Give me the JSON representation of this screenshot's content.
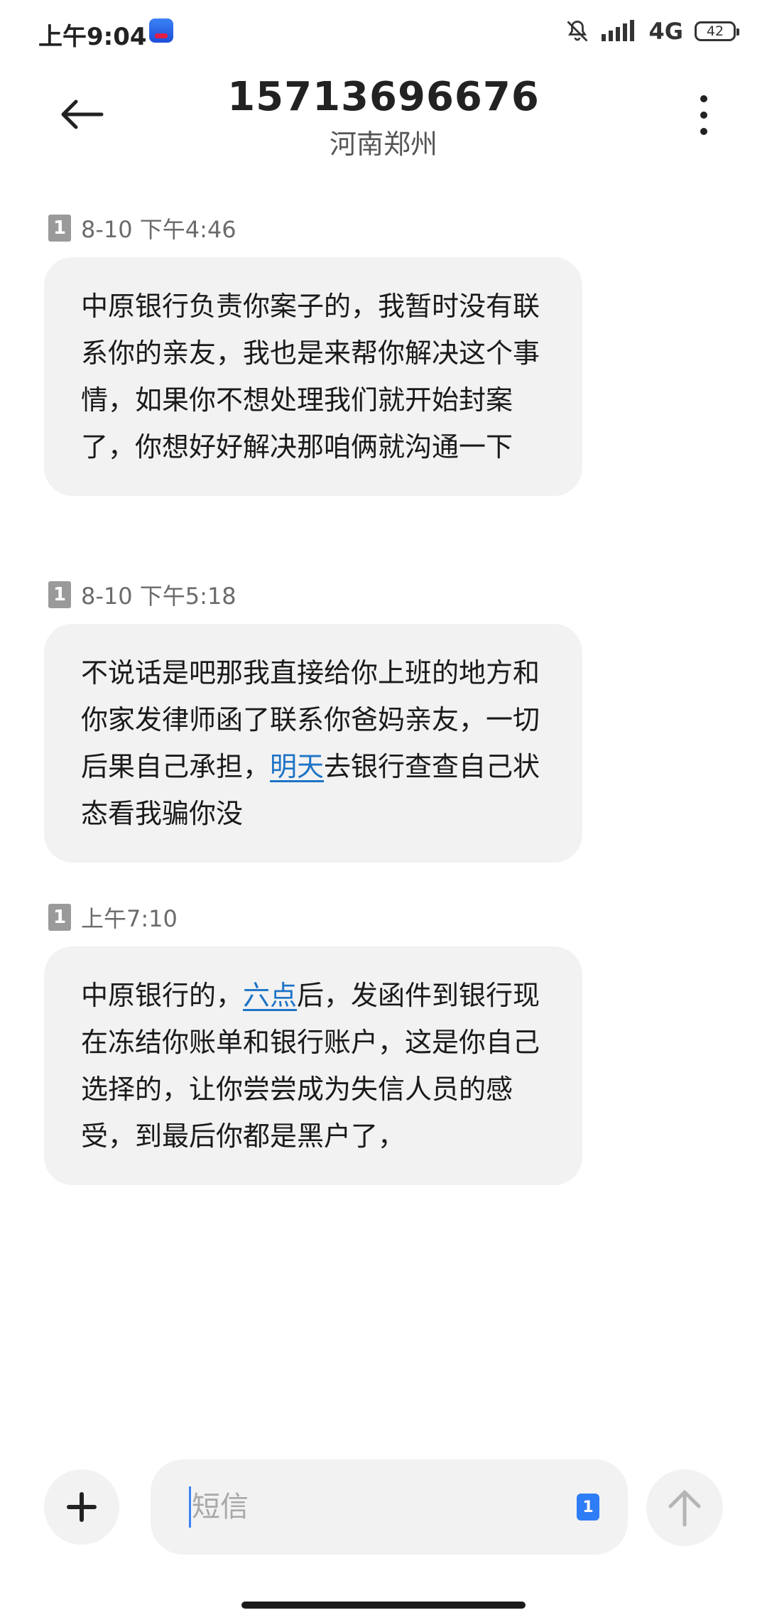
{
  "status_bar": {
    "time": "上午9:04",
    "network": "4G",
    "battery": "42"
  },
  "header": {
    "title": "15713696676",
    "subtitle": "河南郑州"
  },
  "messages": [
    {
      "sim": "1",
      "timestamp": "8-10 下午4:46",
      "parts": {
        "p0": "中原银行负责你案子的，我暂时没有联系你的亲友，我也是来帮你解决这个事情，如果你不想处理我们就开始封案了，你想好好解决那咱俩就沟通一下"
      }
    },
    {
      "sim": "1",
      "timestamp": "8-10 下午5:18",
      "parts": {
        "p0": "不说话是吧那我直接给你上班的地方和你家发律师函了联系你爸妈亲友，一切后果自己承担，",
        "link": "明天",
        "p1": "去银行查查自己状态看我骗你没"
      }
    },
    {
      "sim": "1",
      "timestamp": "上午7:10",
      "parts": {
        "p0": "中原银行的，",
        "link": "六点",
        "p1": "后，发函件到银行现在冻结你账单和银行账户，这是你自己选择的，让你尝尝成为失信人员的感受，到最后你都是黑户了，"
      }
    }
  ],
  "composer": {
    "placeholder": "短信",
    "value": "",
    "sim": "1"
  },
  "icons": {
    "back": "arrow-left-icon",
    "more": "more-vertical-icon",
    "add": "plus-icon",
    "send": "arrow-up-icon",
    "mute": "bell-off-icon",
    "signal": "signal-icon"
  }
}
